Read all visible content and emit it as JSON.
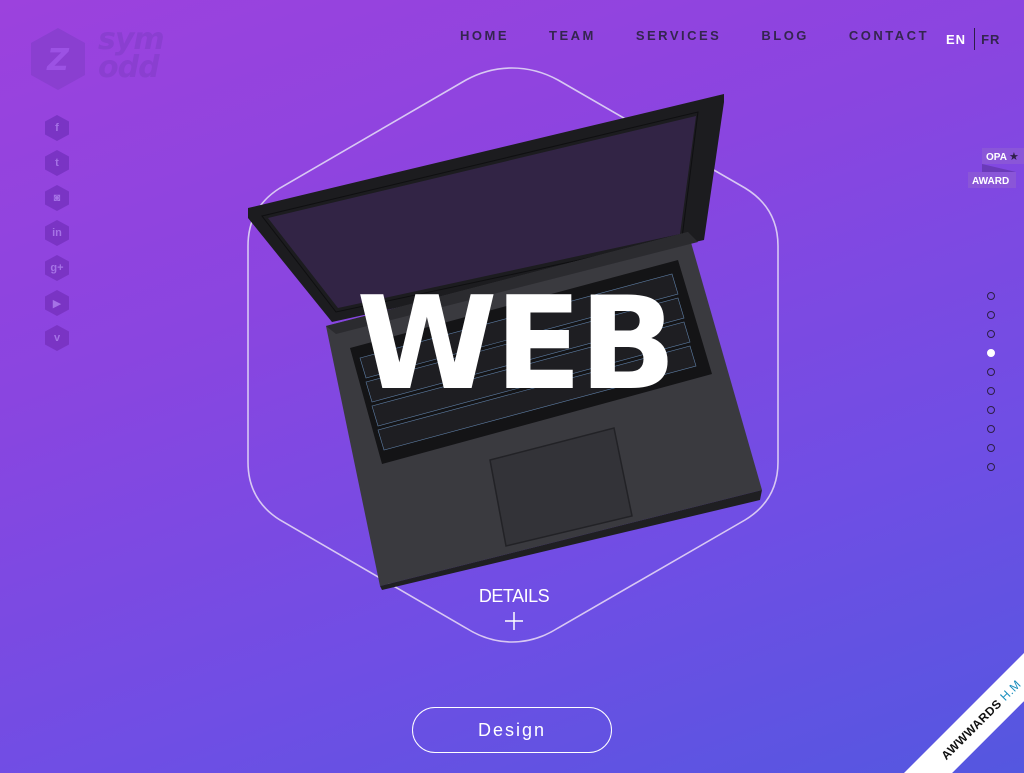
{
  "brand": {
    "logo_text": "sym odd"
  },
  "nav": {
    "items": [
      "HOME",
      "TEAM",
      "SERVICES",
      "BLOG",
      "CONTACT"
    ]
  },
  "lang": {
    "current": "EN",
    "other": "FR"
  },
  "social": [
    {
      "name": "facebook-icon",
      "glyph": "f"
    },
    {
      "name": "twitter-icon",
      "glyph": "t"
    },
    {
      "name": "instagram-icon",
      "glyph": "◙"
    },
    {
      "name": "linkedin-icon",
      "glyph": "in"
    },
    {
      "name": "googleplus-icon",
      "glyph": "g+"
    },
    {
      "name": "youtube-icon",
      "glyph": "▶"
    },
    {
      "name": "vimeo-icon",
      "glyph": "v"
    }
  ],
  "opa": {
    "line1": "OPA",
    "line2": "AWARD"
  },
  "pager": {
    "count": 10,
    "active": 3
  },
  "hero": {
    "title": "WEB",
    "details": "DETAILS"
  },
  "cta": {
    "label": "Design"
  },
  "ribbon": {
    "text": "AWWWARDS",
    "suffix": "H.M"
  },
  "colors": {
    "accent": "#ffffff",
    "dark": "#34254f",
    "bg_start": "#9c42dd",
    "bg_end": "#5457e0"
  }
}
